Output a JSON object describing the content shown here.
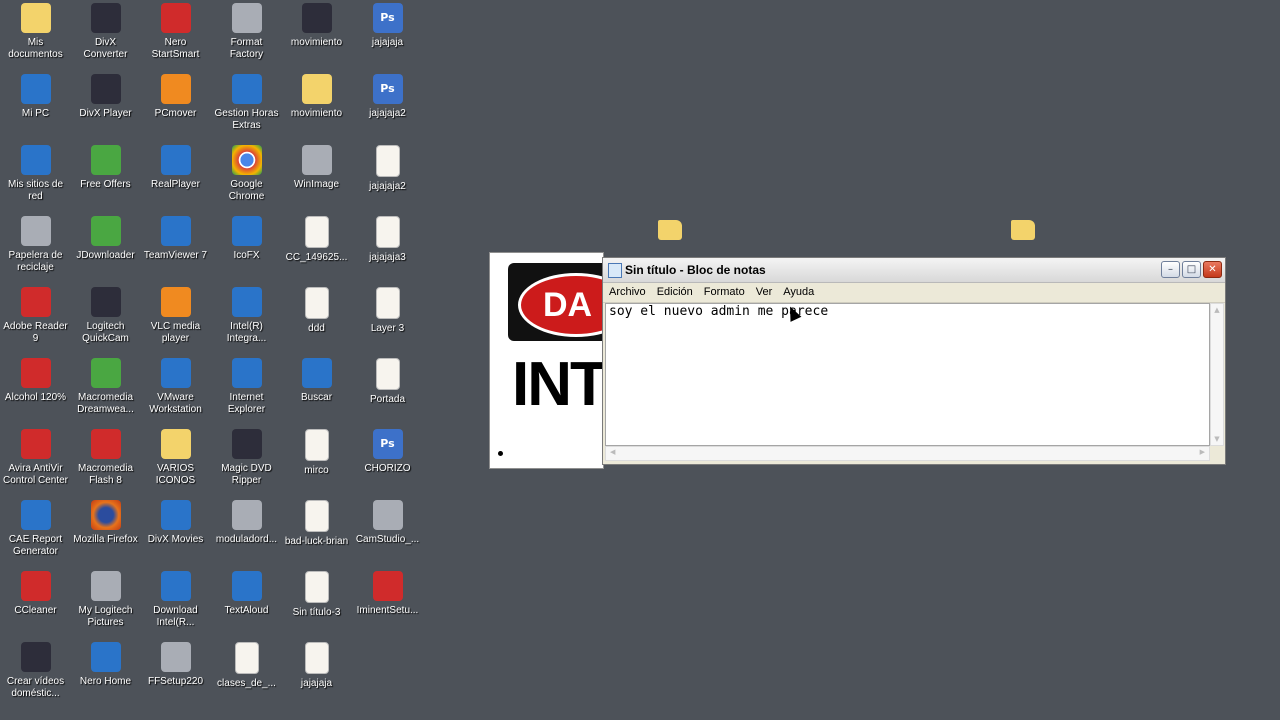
{
  "desktop": {
    "icons": [
      {
        "label": "Mis\ndocumentos",
        "icon": "my-documents-icon",
        "style": "g-folder"
      },
      {
        "label": "DivX\nConverter",
        "icon": "divx-converter-icon",
        "style": "g-dark"
      },
      {
        "label": "Nero\nStartSmart",
        "icon": "nero-startsmart-icon",
        "style": "g-red"
      },
      {
        "label": "Format\nFactory",
        "icon": "format-factory-icon",
        "style": "g-gray"
      },
      {
        "label": "movimiento",
        "icon": "winrar-archive-icon",
        "style": "g-dark"
      },
      {
        "label": "jajajaja",
        "icon": "photoshop-file-icon",
        "style": "g-ps"
      },
      {
        "label": "Mi PC",
        "icon": "my-computer-icon",
        "style": "g-blue"
      },
      {
        "label": "DivX Player",
        "icon": "divx-player-icon",
        "style": "g-dark"
      },
      {
        "label": "PCmover",
        "icon": "pcmover-icon",
        "style": "g-orange"
      },
      {
        "label": "Gestion Horas\nExtras",
        "icon": "gestion-horas-icon",
        "style": "g-blue"
      },
      {
        "label": "movimiento",
        "icon": "folder-icon",
        "style": "g-folder"
      },
      {
        "label": "jajajaja2",
        "icon": "photoshop-file-icon",
        "style": "g-ps"
      },
      {
        "label": "Mis sitios de\nred",
        "icon": "network-places-icon",
        "style": "g-blue"
      },
      {
        "label": "Free Offers",
        "icon": "free-offers-icon",
        "style": "g-green"
      },
      {
        "label": "RealPlayer",
        "icon": "realplayer-icon",
        "style": "g-blue"
      },
      {
        "label": "Google\nChrome",
        "icon": "chrome-icon",
        "style": "g-chrome"
      },
      {
        "label": "WinImage",
        "icon": "winimage-icon",
        "style": "g-gray"
      },
      {
        "label": "jajajaja2",
        "icon": "image-file-icon",
        "style": "g-doc"
      },
      {
        "label": "Papelera de\nreciclaje",
        "icon": "recycle-bin-icon",
        "style": "g-gray"
      },
      {
        "label": "JDownloader",
        "icon": "jdownloader-icon",
        "style": "g-green"
      },
      {
        "label": "TeamViewer 7",
        "icon": "teamviewer-icon",
        "style": "g-blue"
      },
      {
        "label": "IcoFX",
        "icon": "icofx-icon",
        "style": "g-blue"
      },
      {
        "label": "CC_149625...",
        "icon": "image-file-icon",
        "style": "g-doc"
      },
      {
        "label": "jajajaja3",
        "icon": "image-file-icon",
        "style": "g-doc"
      },
      {
        "label": "Adobe Reader\n9",
        "icon": "adobe-reader-icon",
        "style": "g-red"
      },
      {
        "label": "Logitech\nQuickCam",
        "icon": "webcam-icon",
        "style": "g-dark"
      },
      {
        "label": "VLC media\nplayer",
        "icon": "vlc-icon",
        "style": "g-orange"
      },
      {
        "label": "Intel(R)\nIntegra...",
        "icon": "intel-icon",
        "style": "g-blue"
      },
      {
        "label": "ddd",
        "icon": "image-file-icon",
        "style": "g-doc"
      },
      {
        "label": "Layer 3",
        "icon": "image-file-icon",
        "style": "g-doc"
      },
      {
        "label": "Alcohol 120%",
        "icon": "alcohol-120-icon",
        "style": "g-red"
      },
      {
        "label": "Macromedia\nDreamwea...",
        "icon": "dreamweaver-icon",
        "style": "g-green"
      },
      {
        "label": "VMware\nWorkstation",
        "icon": "vmware-icon",
        "style": "g-blue"
      },
      {
        "label": "Internet\nExplorer",
        "icon": "internet-explorer-icon",
        "style": "g-blue"
      },
      {
        "label": "Buscar",
        "icon": "search-icon",
        "style": "g-blue"
      },
      {
        "label": "Portada",
        "icon": "image-file-icon",
        "style": "g-doc"
      },
      {
        "label": "Avira AntiVir\nControl Center",
        "icon": "avira-icon",
        "style": "g-red"
      },
      {
        "label": "Macromedia\nFlash 8",
        "icon": "flash-icon",
        "style": "g-red"
      },
      {
        "label": "VARIOS\nICONOS",
        "icon": "folder-icon",
        "style": "g-folder"
      },
      {
        "label": "Magic DVD\nRipper",
        "icon": "dvd-ripper-icon",
        "style": "g-dark"
      },
      {
        "label": "mirco",
        "icon": "text-file-icon",
        "style": "g-doc"
      },
      {
        "label": "CHORIZO",
        "icon": "photoshop-file-icon",
        "style": "g-ps"
      },
      {
        "label": "CAE Report\nGenerator",
        "icon": "report-icon",
        "style": "g-blue"
      },
      {
        "label": "Mozilla Firefox",
        "icon": "firefox-icon",
        "style": "g-ff"
      },
      {
        "label": "DivX Movies",
        "icon": "divx-movies-icon",
        "style": "g-blue"
      },
      {
        "label": "moduladord...",
        "icon": "modulador-icon",
        "style": "g-gray"
      },
      {
        "label": "bad-luck-brian",
        "icon": "image-file-icon",
        "style": "g-doc"
      },
      {
        "label": "CamStudio_...",
        "icon": "installer-icon",
        "style": "g-gray"
      },
      {
        "label": "CCleaner",
        "icon": "ccleaner-icon",
        "style": "g-red"
      },
      {
        "label": "My Logitech\nPictures",
        "icon": "logitech-pictures-icon",
        "style": "g-gray"
      },
      {
        "label": "Download\nIntel(R...",
        "icon": "intel-icon",
        "style": "g-blue"
      },
      {
        "label": "TextAloud",
        "icon": "textaloud-icon",
        "style": "g-blue"
      },
      {
        "label": "Sin título-3",
        "icon": "image-file-icon",
        "style": "g-doc"
      },
      {
        "label": "IminentSetu...",
        "icon": "iminent-icon",
        "style": "g-red"
      },
      {
        "label": "Crear vídeos\ndoméstic...",
        "icon": "video-maker-icon",
        "style": "g-dark"
      },
      {
        "label": "Nero Home",
        "icon": "nero-home-icon",
        "style": "g-blue"
      },
      {
        "label": "FFSetup220",
        "icon": "ffsetup-icon",
        "style": "g-gray"
      },
      {
        "label": "clases_de_...",
        "icon": "image-file-icon",
        "style": "g-doc"
      },
      {
        "label": "jajajaja",
        "icon": "image-file-icon",
        "style": "g-doc"
      }
    ]
  },
  "background_window": {
    "sign_top_text": "DA",
    "sign_bottom_text": "INTI"
  },
  "notepad": {
    "title": "Sin título - Bloc de notas",
    "menu": [
      "Archivo",
      "Edición",
      "Formato",
      "Ver",
      "Ayuda"
    ],
    "content": "soy el nuevo admin me parece",
    "buttons": {
      "minimize": "–",
      "maximize": "□",
      "close": "✕"
    }
  }
}
